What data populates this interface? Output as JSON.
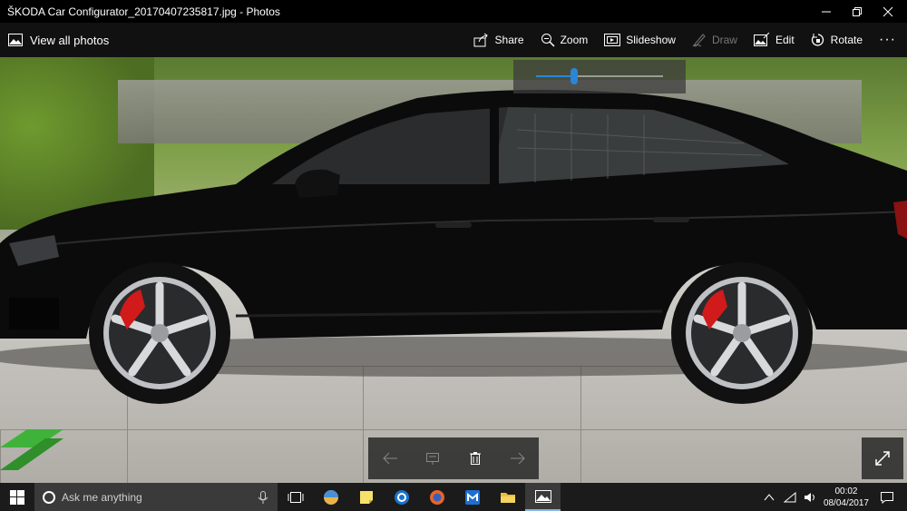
{
  "window": {
    "title": "ŠKODA Car Configurator_20170407235817.jpg - Photos",
    "minimize_icon": "minimize-icon",
    "maximize_icon": "restore-icon",
    "close_icon": "close-icon"
  },
  "commandbar": {
    "back_label": "View all photos",
    "commands": [
      {
        "label": "Share",
        "icon": "share-icon",
        "enabled": true
      },
      {
        "label": "Zoom",
        "icon": "zoom-icon",
        "enabled": true
      },
      {
        "label": "Slideshow",
        "icon": "slideshow-icon",
        "enabled": true
      },
      {
        "label": "Draw",
        "icon": "draw-icon",
        "enabled": false
      },
      {
        "label": "Edit",
        "icon": "edit-icon",
        "enabled": true
      },
      {
        "label": "Rotate",
        "icon": "rotate-icon",
        "enabled": true
      }
    ],
    "more_label": "···"
  },
  "zoom_slider": {
    "level": 0.3
  },
  "navigation": {
    "prev_icon": "arrow-left-icon",
    "slideshow_icon": "present-icon",
    "delete_icon": "trash-icon",
    "next_icon": "arrow-right-icon",
    "fullscreen_icon": "expand-icon"
  },
  "taskbar": {
    "search_placeholder": "Ask me anything",
    "time": "00:02",
    "date": "08/04/2017",
    "apps": [
      "task-view-icon",
      "app-icon",
      "sticky-notes-icon",
      "outlook-icon",
      "firefox-icon",
      "maxthon-icon",
      "file-explorer-icon",
      "photos-icon"
    ]
  },
  "colors": {
    "accent": "#2a86d6",
    "car_body": "#0b0b0c",
    "brake_caliper": "#d11a1a",
    "chevron_green": "#3fb23a"
  }
}
